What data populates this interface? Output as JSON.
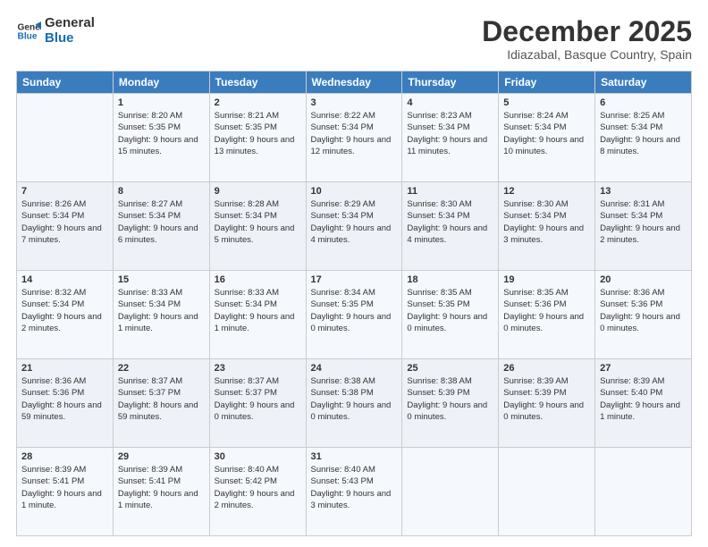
{
  "header": {
    "logo_line1": "General",
    "logo_line2": "Blue",
    "title": "December 2025",
    "subtitle": "Idiazabal, Basque Country, Spain"
  },
  "columns": [
    "Sunday",
    "Monday",
    "Tuesday",
    "Wednesday",
    "Thursday",
    "Friday",
    "Saturday"
  ],
  "weeks": [
    [
      {
        "day": "",
        "sunrise": "",
        "sunset": "",
        "daylight": ""
      },
      {
        "day": "1",
        "sunrise": "Sunrise: 8:20 AM",
        "sunset": "Sunset: 5:35 PM",
        "daylight": "Daylight: 9 hours and 15 minutes."
      },
      {
        "day": "2",
        "sunrise": "Sunrise: 8:21 AM",
        "sunset": "Sunset: 5:35 PM",
        "daylight": "Daylight: 9 hours and 13 minutes."
      },
      {
        "day": "3",
        "sunrise": "Sunrise: 8:22 AM",
        "sunset": "Sunset: 5:34 PM",
        "daylight": "Daylight: 9 hours and 12 minutes."
      },
      {
        "day": "4",
        "sunrise": "Sunrise: 8:23 AM",
        "sunset": "Sunset: 5:34 PM",
        "daylight": "Daylight: 9 hours and 11 minutes."
      },
      {
        "day": "5",
        "sunrise": "Sunrise: 8:24 AM",
        "sunset": "Sunset: 5:34 PM",
        "daylight": "Daylight: 9 hours and 10 minutes."
      },
      {
        "day": "6",
        "sunrise": "Sunrise: 8:25 AM",
        "sunset": "Sunset: 5:34 PM",
        "daylight": "Daylight: 9 hours and 8 minutes."
      }
    ],
    [
      {
        "day": "7",
        "sunrise": "Sunrise: 8:26 AM",
        "sunset": "Sunset: 5:34 PM",
        "daylight": "Daylight: 9 hours and 7 minutes."
      },
      {
        "day": "8",
        "sunrise": "Sunrise: 8:27 AM",
        "sunset": "Sunset: 5:34 PM",
        "daylight": "Daylight: 9 hours and 6 minutes."
      },
      {
        "day": "9",
        "sunrise": "Sunrise: 8:28 AM",
        "sunset": "Sunset: 5:34 PM",
        "daylight": "Daylight: 9 hours and 5 minutes."
      },
      {
        "day": "10",
        "sunrise": "Sunrise: 8:29 AM",
        "sunset": "Sunset: 5:34 PM",
        "daylight": "Daylight: 9 hours and 4 minutes."
      },
      {
        "day": "11",
        "sunrise": "Sunrise: 8:30 AM",
        "sunset": "Sunset: 5:34 PM",
        "daylight": "Daylight: 9 hours and 4 minutes."
      },
      {
        "day": "12",
        "sunrise": "Sunrise: 8:30 AM",
        "sunset": "Sunset: 5:34 PM",
        "daylight": "Daylight: 9 hours and 3 minutes."
      },
      {
        "day": "13",
        "sunrise": "Sunrise: 8:31 AM",
        "sunset": "Sunset: 5:34 PM",
        "daylight": "Daylight: 9 hours and 2 minutes."
      }
    ],
    [
      {
        "day": "14",
        "sunrise": "Sunrise: 8:32 AM",
        "sunset": "Sunset: 5:34 PM",
        "daylight": "Daylight: 9 hours and 2 minutes."
      },
      {
        "day": "15",
        "sunrise": "Sunrise: 8:33 AM",
        "sunset": "Sunset: 5:34 PM",
        "daylight": "Daylight: 9 hours and 1 minute."
      },
      {
        "day": "16",
        "sunrise": "Sunrise: 8:33 AM",
        "sunset": "Sunset: 5:34 PM",
        "daylight": "Daylight: 9 hours and 1 minute."
      },
      {
        "day": "17",
        "sunrise": "Sunrise: 8:34 AM",
        "sunset": "Sunset: 5:35 PM",
        "daylight": "Daylight: 9 hours and 0 minutes."
      },
      {
        "day": "18",
        "sunrise": "Sunrise: 8:35 AM",
        "sunset": "Sunset: 5:35 PM",
        "daylight": "Daylight: 9 hours and 0 minutes."
      },
      {
        "day": "19",
        "sunrise": "Sunrise: 8:35 AM",
        "sunset": "Sunset: 5:36 PM",
        "daylight": "Daylight: 9 hours and 0 minutes."
      },
      {
        "day": "20",
        "sunrise": "Sunrise: 8:36 AM",
        "sunset": "Sunset: 5:36 PM",
        "daylight": "Daylight: 9 hours and 0 minutes."
      }
    ],
    [
      {
        "day": "21",
        "sunrise": "Sunrise: 8:36 AM",
        "sunset": "Sunset: 5:36 PM",
        "daylight": "Daylight: 8 hours and 59 minutes."
      },
      {
        "day": "22",
        "sunrise": "Sunrise: 8:37 AM",
        "sunset": "Sunset: 5:37 PM",
        "daylight": "Daylight: 8 hours and 59 minutes."
      },
      {
        "day": "23",
        "sunrise": "Sunrise: 8:37 AM",
        "sunset": "Sunset: 5:37 PM",
        "daylight": "Daylight: 9 hours and 0 minutes."
      },
      {
        "day": "24",
        "sunrise": "Sunrise: 8:38 AM",
        "sunset": "Sunset: 5:38 PM",
        "daylight": "Daylight: 9 hours and 0 minutes."
      },
      {
        "day": "25",
        "sunrise": "Sunrise: 8:38 AM",
        "sunset": "Sunset: 5:39 PM",
        "daylight": "Daylight: 9 hours and 0 minutes."
      },
      {
        "day": "26",
        "sunrise": "Sunrise: 8:39 AM",
        "sunset": "Sunset: 5:39 PM",
        "daylight": "Daylight: 9 hours and 0 minutes."
      },
      {
        "day": "27",
        "sunrise": "Sunrise: 8:39 AM",
        "sunset": "Sunset: 5:40 PM",
        "daylight": "Daylight: 9 hours and 1 minute."
      }
    ],
    [
      {
        "day": "28",
        "sunrise": "Sunrise: 8:39 AM",
        "sunset": "Sunset: 5:41 PM",
        "daylight": "Daylight: 9 hours and 1 minute."
      },
      {
        "day": "29",
        "sunrise": "Sunrise: 8:39 AM",
        "sunset": "Sunset: 5:41 PM",
        "daylight": "Daylight: 9 hours and 1 minute."
      },
      {
        "day": "30",
        "sunrise": "Sunrise: 8:40 AM",
        "sunset": "Sunset: 5:42 PM",
        "daylight": "Daylight: 9 hours and 2 minutes."
      },
      {
        "day": "31",
        "sunrise": "Sunrise: 8:40 AM",
        "sunset": "Sunset: 5:43 PM",
        "daylight": "Daylight: 9 hours and 3 minutes."
      },
      {
        "day": "",
        "sunrise": "",
        "sunset": "",
        "daylight": ""
      },
      {
        "day": "",
        "sunrise": "",
        "sunset": "",
        "daylight": ""
      },
      {
        "day": "",
        "sunrise": "",
        "sunset": "",
        "daylight": ""
      }
    ]
  ]
}
